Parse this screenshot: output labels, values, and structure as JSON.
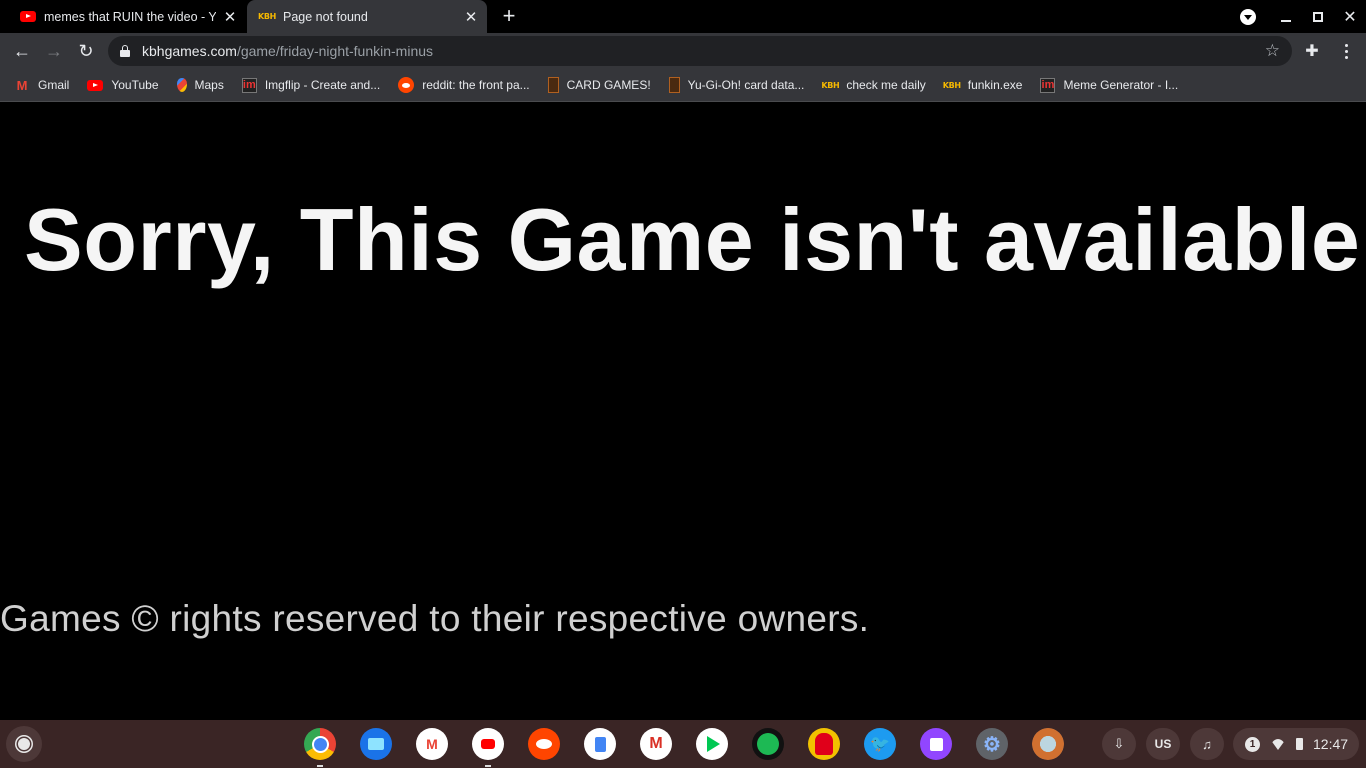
{
  "browser": {
    "tabs": [
      {
        "title": "memes that RUIN the video - YouTube",
        "favicon": "youtube-icon",
        "active": false
      },
      {
        "title": "Page not found",
        "favicon": "kbh-icon",
        "favicon_text": "KBH",
        "active": true
      }
    ],
    "new_tab_symbol": "+",
    "close_symbol": "✕",
    "url_host": "kbhgames.com",
    "url_path": "/game/friday-night-funkin-minus",
    "star_symbol": "☆",
    "extensions_symbol": "✚"
  },
  "bookmarks": [
    {
      "label": "Gmail",
      "icon": "gmail-icon",
      "icon_text": "M"
    },
    {
      "label": "YouTube",
      "icon": "youtube-icon"
    },
    {
      "label": "Maps",
      "icon": "maps-icon"
    },
    {
      "label": "Imgflip - Create and...",
      "icon": "imgflip-icon",
      "icon_text": "im"
    },
    {
      "label": "reddit: the front pa...",
      "icon": "reddit-icon"
    },
    {
      "label": "CARD GAMES!",
      "icon": "card-icon"
    },
    {
      "label": "Yu-Gi-Oh! card data...",
      "icon": "card-icon"
    },
    {
      "label": "check me daily",
      "icon": "kbh-icon",
      "icon_text": "KBH"
    },
    {
      "label": "funkin.exe",
      "icon": "kbh-icon",
      "icon_text": "KBH"
    },
    {
      "label": "Meme Generator - I...",
      "icon": "imgflip-icon",
      "icon_text": "im"
    }
  ],
  "page": {
    "headline": "Sorry, This Game isn't available.",
    "footer_note": "Games © rights reserved to their respective owners."
  },
  "shelf": {
    "apps": [
      {
        "name": "Chrome",
        "running": true
      },
      {
        "name": "Files"
      },
      {
        "name": "Gmail",
        "text": "M"
      },
      {
        "name": "YouTube",
        "running": true
      },
      {
        "name": "Reddit"
      },
      {
        "name": "Docs"
      },
      {
        "name": "Gmail (web)",
        "text": "M"
      },
      {
        "name": "Play Store"
      },
      {
        "name": "Spotify"
      },
      {
        "name": "Among Us"
      },
      {
        "name": "Twitter",
        "text": "🐦"
      },
      {
        "name": "Twitch"
      },
      {
        "name": "Settings",
        "text": "⚙"
      },
      {
        "name": "Game"
      }
    ],
    "ime": "US",
    "notification_count": "1",
    "clock": "12:47"
  }
}
